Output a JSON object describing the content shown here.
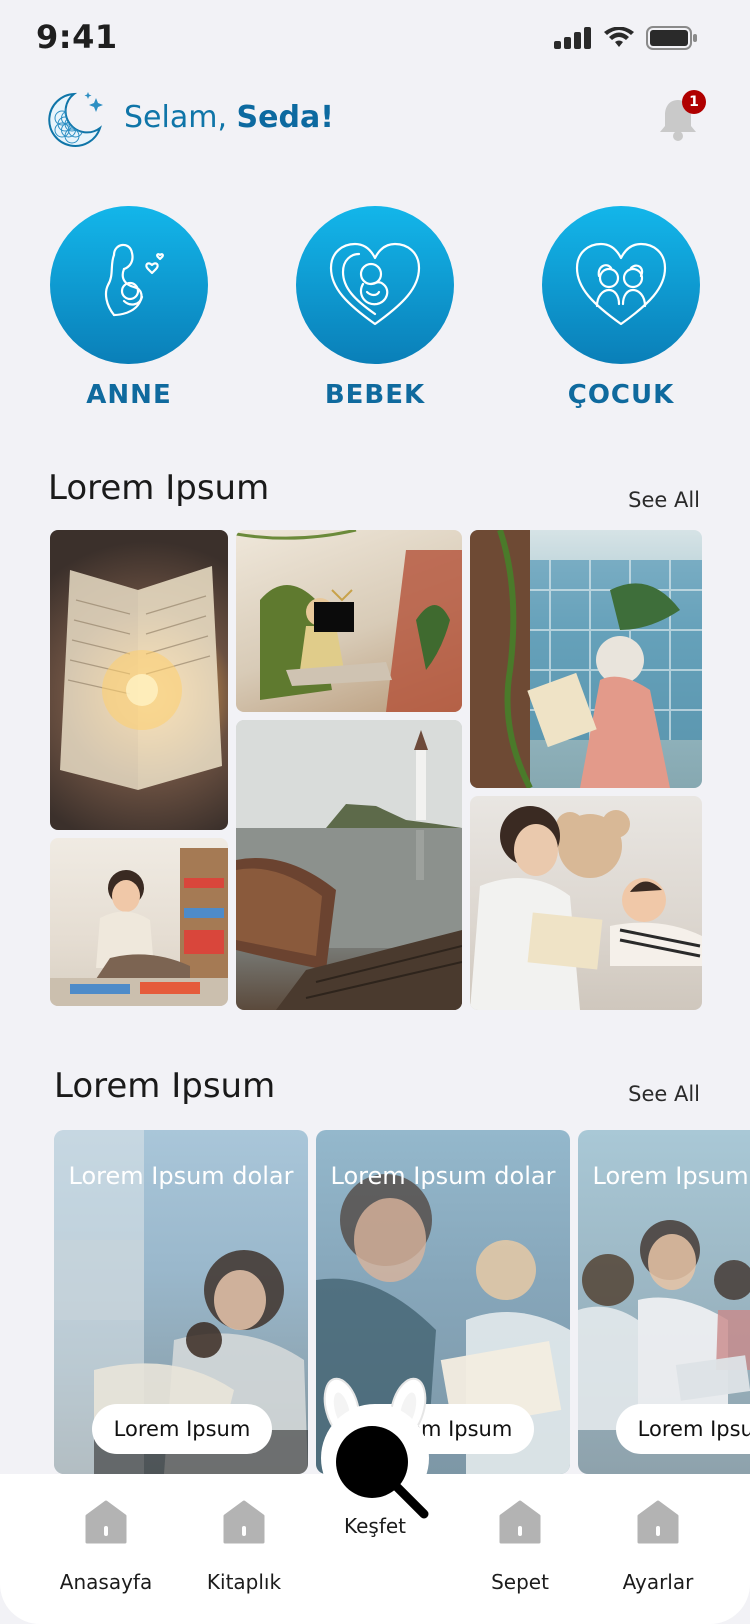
{
  "status_bar": {
    "time": "9:41"
  },
  "header": {
    "greeting": "Selam,",
    "name": "Seda!",
    "logo_icon": "moon-flower-icon",
    "notification_icon": "bell-icon",
    "notification_count": "1"
  },
  "categories": [
    {
      "label": "ANNE",
      "icon": "mother-baby-icon"
    },
    {
      "label": "BEBEK",
      "icon": "baby-heart-icon"
    },
    {
      "label": "ÇOCUK",
      "icon": "children-heart-icon"
    }
  ],
  "section1": {
    "title": "Lorem Ipsum",
    "see_all": "See All"
  },
  "section2": {
    "title": "Lorem Ipsum",
    "see_all": "See All",
    "cards": [
      {
        "caption": "Lorem Ipsum dolar",
        "button": "Lorem Ipsum"
      },
      {
        "caption": "Lorem Ipsum dolar",
        "button": "Lorem Ipsum"
      },
      {
        "caption": "Lorem Ipsum dolar",
        "button": "Lorem Ipsum"
      }
    ]
  },
  "tabbar": {
    "items": [
      {
        "label": "Anasayfa",
        "icon": "home-icon"
      },
      {
        "label": "Kitaplık",
        "icon": "home-icon"
      },
      {
        "label": "Keşfet",
        "icon": "search-icon"
      },
      {
        "label": "Sepet",
        "icon": "home-icon"
      },
      {
        "label": "Ayarlar",
        "icon": "home-icon"
      }
    ]
  },
  "colors": {
    "accent": "#0f75a8",
    "circle_top": "#13b6ea",
    "circle_bottom": "#0a7fb8",
    "badge": "#b00000",
    "background": "#f2f2f6"
  }
}
